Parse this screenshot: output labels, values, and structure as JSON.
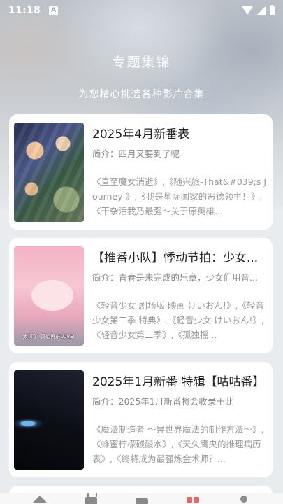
{
  "status": {
    "time": "11:18",
    "notif_letter": "A"
  },
  "header": {
    "title": "专题集锦",
    "subtitle": "为您精心挑选各种影片合集"
  },
  "cards": [
    {
      "title": "2025年4月新番表",
      "desc": "简介：四月又要到了呢",
      "works": "《直至魔女消逝》,《随兴旅-That&#039;s Journey-》,《我是星际国家的恶德领主！》,《干杂活我乃最强～关于原英雄..."
    },
    {
      "title": "【推番小队】悸动节拍：少女...",
      "desc": "简介：青春是未完成的乐章，少女们用音...",
      "works": "《轻音少女 剧场版 映画 けいおん!》,《轻音少女第二季 特典》,《轻音少女 けいおん!》,《轻音少女第二季》,《孤独摇...",
      "thumb_caption": "太棒了, 真想再来LOVE!"
    },
    {
      "title": "2025年1月新番 特辑【咕咕番】",
      "desc": "简介：2025年1月新番将会收录于此",
      "works": "《魔法制造者 ～异世界魔法的制作方法～》,《蜂蜜柠檬碳酸水》,《天久鹰央的推理病历表》,《终将成为最强炼金术师？..."
    }
  ],
  "tabbar": {
    "items": [
      {
        "icon": "home-icon"
      },
      {
        "icon": "tv-icon"
      },
      {
        "icon": "game-icon"
      },
      {
        "icon": "topic-icon",
        "active": true,
        "color": "#e06a6a"
      },
      {
        "icon": "user-icon"
      }
    ]
  }
}
